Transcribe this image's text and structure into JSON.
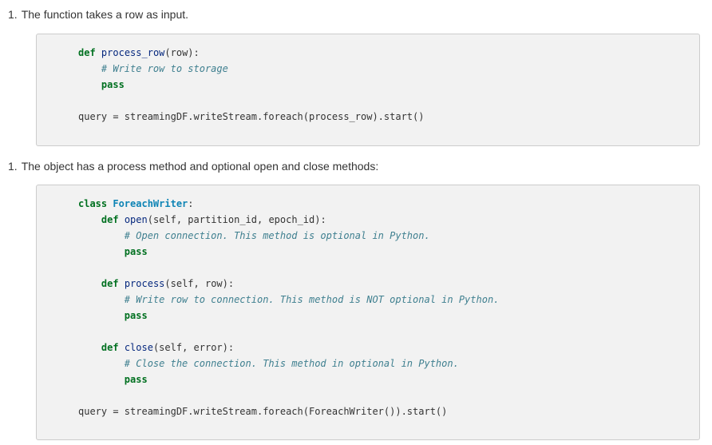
{
  "items": [
    {
      "number": "1.",
      "text": "The function takes a row as input."
    },
    {
      "number": "1.",
      "text": "The object has a process method and optional open and close methods:"
    }
  ],
  "code1": {
    "def_kw": "def",
    "func_name": "process_row",
    "func_sig": "(row):",
    "comment": "# Write row to storage",
    "pass_kw": "pass",
    "query_line": "query = streamingDF.writeStream.foreach(process_row).start()"
  },
  "code2": {
    "class_kw": "class",
    "class_name": "ForeachWriter",
    "class_colon": ":",
    "def_kw": "def",
    "pass_kw": "pass",
    "open_name": "open",
    "open_sig": "(self, partition_id, epoch_id):",
    "open_comment": "# Open connection. This method is optional in Python.",
    "process_name": "process",
    "process_sig": "(self, row):",
    "process_comment": "# Write row to connection. This method is NOT optional in Python.",
    "close_name": "close",
    "close_sig": "(self, error):",
    "close_comment": "# Close the connection. This method in optional in Python.",
    "query_line": "query = streamingDF.writeStream.foreach(ForeachWriter()).start()"
  }
}
